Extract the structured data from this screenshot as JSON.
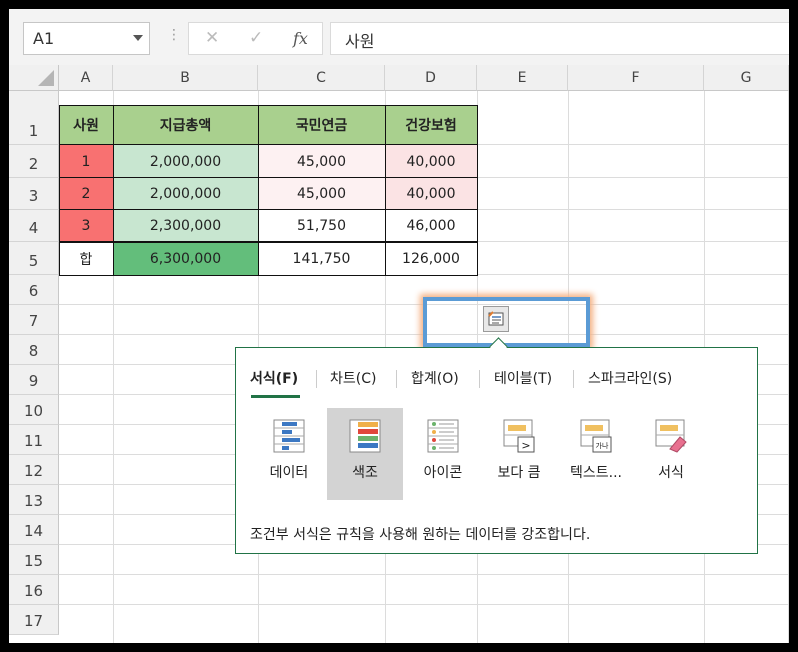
{
  "name_box": "A1",
  "formula_value": "사원",
  "formula_buttons": {
    "cancel": "✕",
    "enter": "✓",
    "fx": "fx"
  },
  "columns": [
    "A",
    "B",
    "C",
    "D",
    "E",
    "F",
    "G"
  ],
  "rows": [
    "1",
    "2",
    "3",
    "4",
    "5",
    "6",
    "7",
    "8",
    "9",
    "10",
    "11",
    "12",
    "13",
    "14",
    "15",
    "16",
    "17"
  ],
  "table": {
    "headers": [
      "사원",
      "지급총액",
      "국민연금",
      "건강보험"
    ],
    "data": [
      [
        "1",
        "2,000,000",
        "45,000",
        "40,000"
      ],
      [
        "2",
        "2,000,000",
        "45,000",
        "40,000"
      ],
      [
        "3",
        "2,300,000",
        "51,750",
        "46,000"
      ]
    ],
    "total": [
      "합",
      "6,300,000",
      "141,750",
      "126,000"
    ]
  },
  "quick_analysis": {
    "tabs": [
      "서식(F)",
      "차트(C)",
      "합계(O)",
      "테이블(T)",
      "스파크라인(S)"
    ],
    "active_tab": "서식(F)",
    "options": [
      "데이터",
      "색조",
      "아이콘",
      "보다 큼",
      "텍스트...",
      "서식"
    ],
    "selected_option": "색조",
    "description": "조건부 서식은 규칙을 사용해 원하는 데이터를 강조합니다."
  },
  "colors": {
    "accent": "#217346",
    "header_fill": "#a9d08e",
    "highlight": "#5b9bd5"
  }
}
